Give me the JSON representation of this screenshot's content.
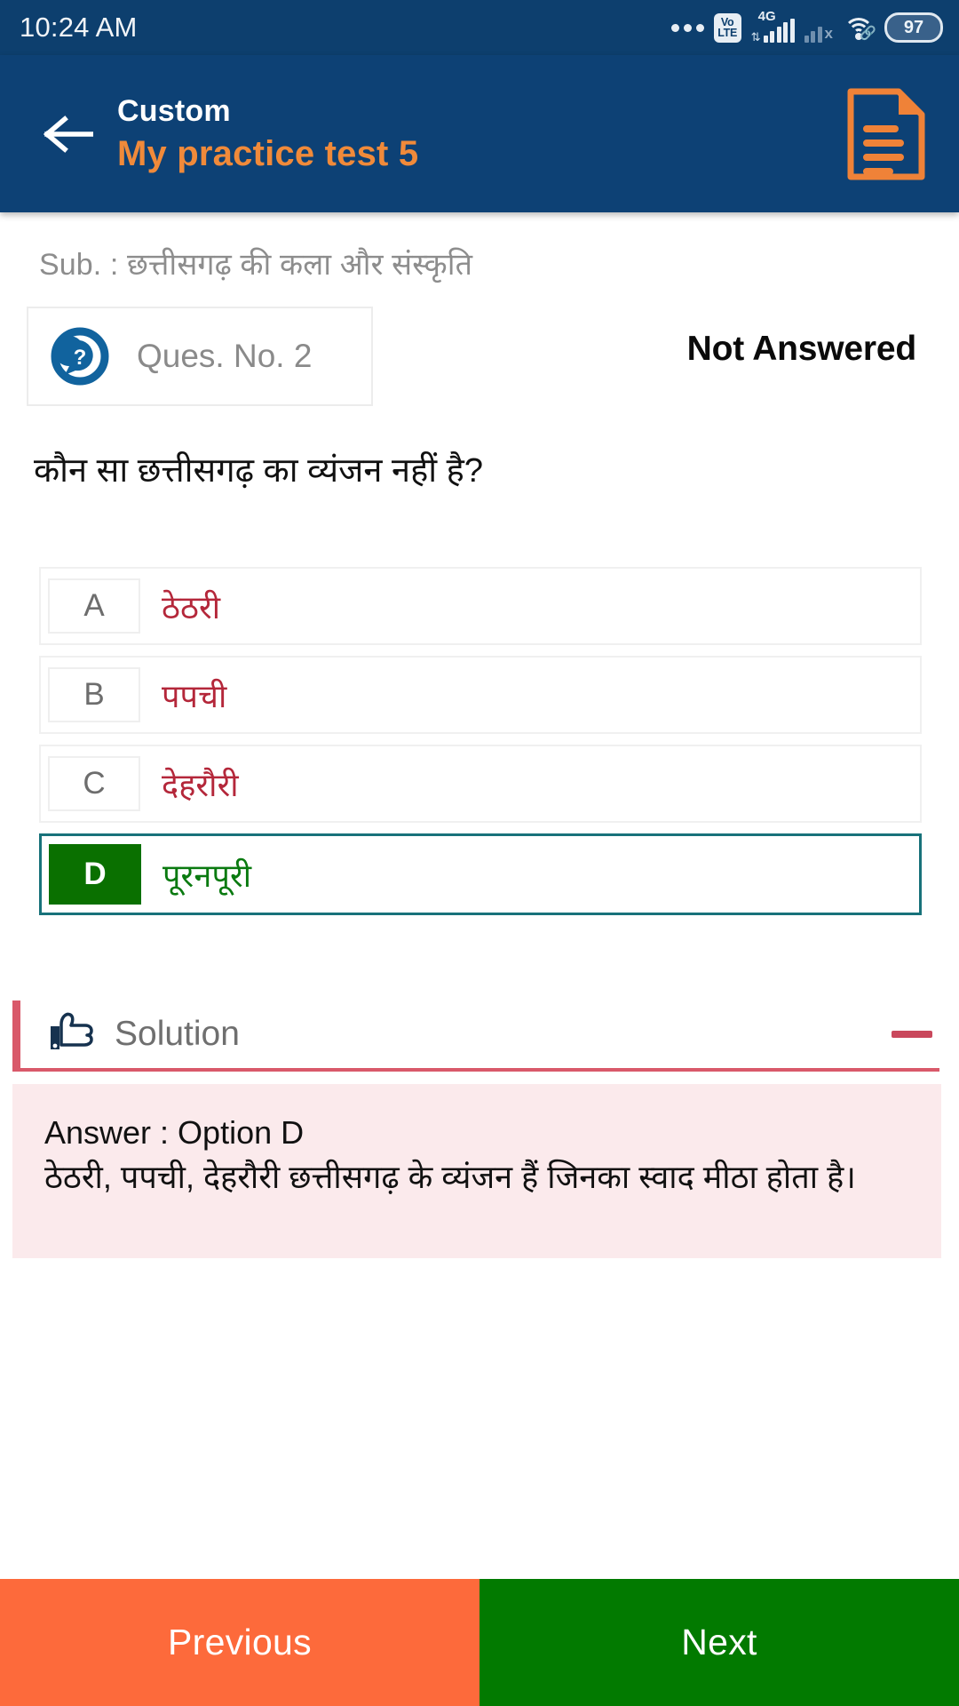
{
  "status_bar": {
    "time": "10:24 AM",
    "overflow_dots": "•••",
    "volte_top": "Vo",
    "volte_bottom": "LTE",
    "network_type": "4G",
    "sim2_no_service": "x",
    "battery_level": "97"
  },
  "app_bar": {
    "back_label": "back",
    "subtitle": "Custom",
    "title": "My practice test 5",
    "doc_icon_name": "document-icon"
  },
  "question_panel": {
    "subject_label": "Sub. : छत्तीसगढ़ की कला और संस्कृति",
    "question_number_label": "Ques. No. 2",
    "answer_status": "Not Answered",
    "question_text": "कौन सा छत्तीसगढ़ का व्यंजन नहीं है?"
  },
  "options": [
    {
      "letter": "A",
      "text": "ठेठरी",
      "correct": false
    },
    {
      "letter": "B",
      "text": "पपची",
      "correct": false
    },
    {
      "letter": "C",
      "text": "देहरौरी",
      "correct": false
    },
    {
      "letter": "D",
      "text": "पूरनपूरी",
      "correct": true
    }
  ],
  "solution": {
    "header_label": "Solution",
    "collapse_icon": "minus-icon",
    "answer_line": "Answer : Option D",
    "explanation_line": "ठेठरी, पपची, देहरौरी छत्तीसगढ़ के व्यंजन हैं जिनका स्वाद मीठा होता है।"
  },
  "footer": {
    "previous_label": "Previous",
    "next_label": "Next"
  },
  "colors": {
    "app_bar": "#0d4175",
    "status_bar": "#0d3f6e",
    "accent_orange": "#f08a3a",
    "option_red": "#b4273a",
    "correct_green": "#0a7000",
    "correct_border": "#18727a",
    "solution_red": "#d9596a",
    "solution_bg": "#fbeaec",
    "previous_btn": "#fd6a3b",
    "next_btn": "#027a00"
  }
}
